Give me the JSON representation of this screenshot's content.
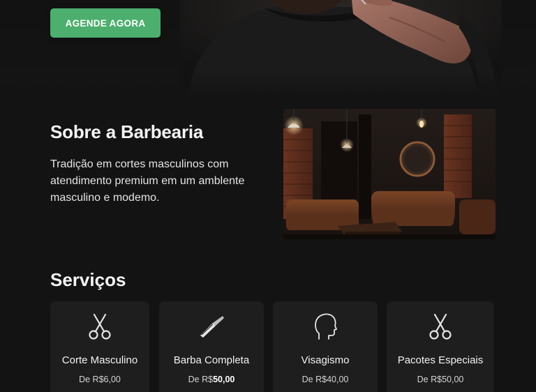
{
  "hero": {
    "cta_label": "AGENDE AGORA"
  },
  "about": {
    "title": "Sobre a Barbearia",
    "text": "Tradição em cortes masculinos com atendimento premium em um amblente masculino e modemo."
  },
  "services": {
    "title": "Serviços",
    "items": [
      {
        "name": "Corte Masculino",
        "price_prefix": "De R$",
        "price_value": "6,00",
        "icon": "scissors-icon"
      },
      {
        "name": "Barba Completa",
        "price_prefix": "De R$",
        "price_value": "50,00",
        "icon": "razor-icon"
      },
      {
        "name": "Visagismo",
        "price_prefix": "De R$",
        "price_value": "40,00",
        "icon": "head-profile-icon"
      },
      {
        "name": "Pacotes Especiais",
        "price_prefix": "De R$",
        "price_value": "50,00",
        "icon": "scissors-icon"
      }
    ]
  },
  "colors": {
    "background": "#131313",
    "card": "#1e1e1e",
    "accent": "#4caf6e",
    "text": "#f2f2f2"
  }
}
